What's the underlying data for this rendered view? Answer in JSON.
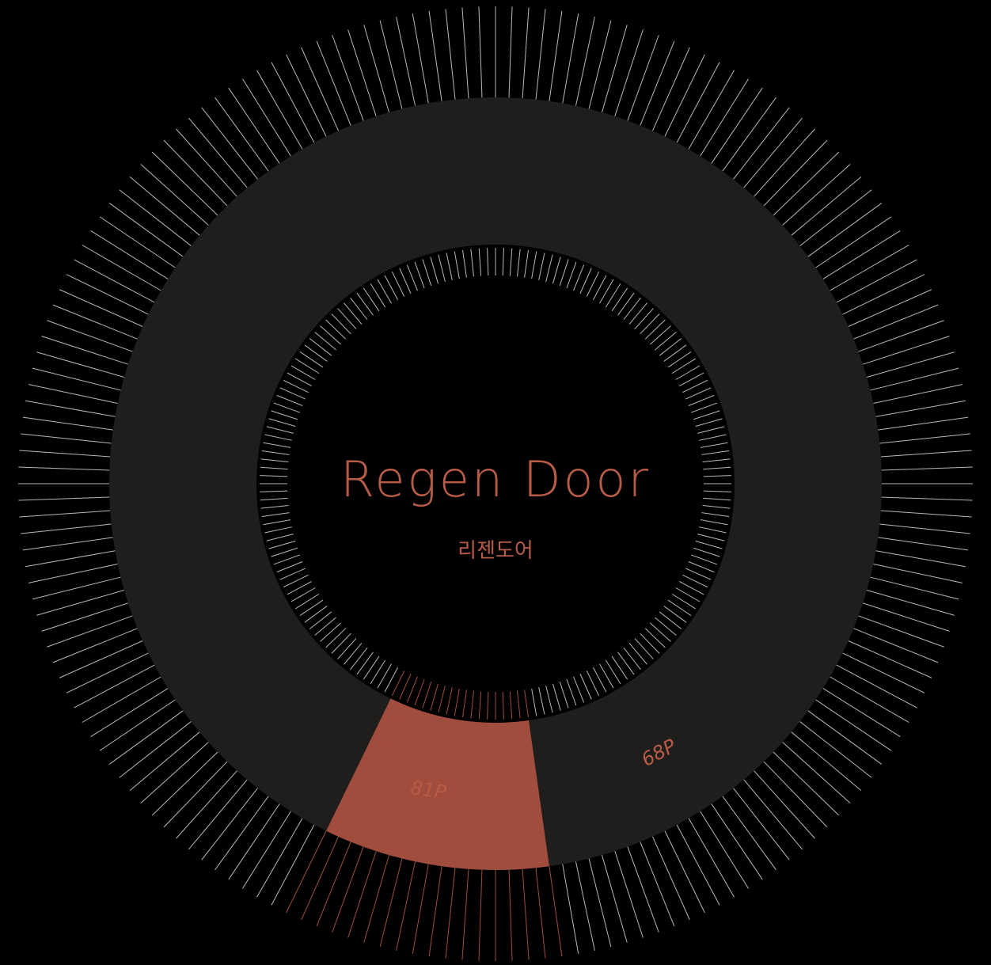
{
  "title": "Regen Door",
  "subtitle": "리젠도어",
  "markers": {
    "start_label": "81P",
    "end_label": "68P"
  },
  "dial": {
    "outer_tick_count": 180,
    "inner_tick_count": 180,
    "highlight_start_deg": 172,
    "highlight_end_deg": 206
  },
  "colors": {
    "background": "#000000",
    "ring": "#1f1e1c",
    "accent": "#a14d3d",
    "label": "#b85c48",
    "tick": "#d8d8d8"
  }
}
